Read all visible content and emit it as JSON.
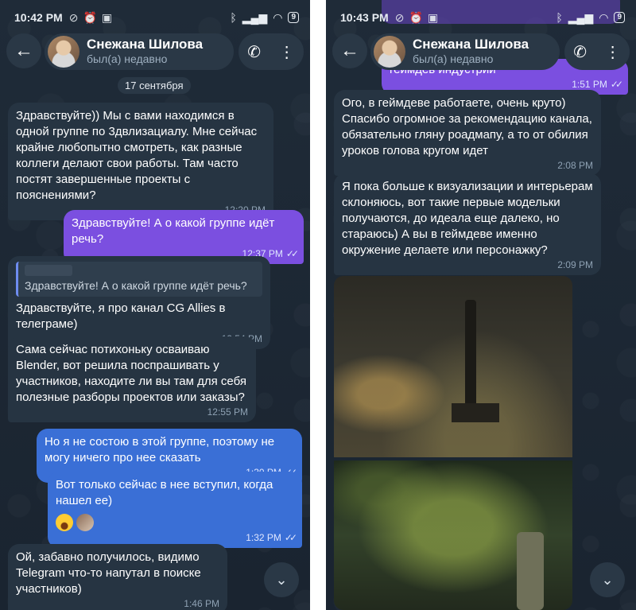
{
  "left": {
    "status": {
      "time": "10:42 PM",
      "battery": "9"
    },
    "contact": {
      "name": "Снежана Шилова",
      "status": "был(а) недавно"
    },
    "date": "17 сентября",
    "messages": [
      {
        "text": "Здравствуйте)) Мы с вами находимся в одной группе по 3двлизациалу. Мне сейчас крайне любопытно смотреть, как разные коллеги делают свои работы. Там часто постят завершенные проекты с пояснениями?",
        "time": "12:20 PM"
      },
      {
        "text": "Здравствуйте! А о какой группе идёт речь?",
        "time": "12:37 PM"
      },
      {
        "reply": "Здравствуйте! А о какой группе идёт речь?",
        "text": "Здравствуйте, я про канал CG Allies в телеграме)",
        "time": "12:54 PM"
      },
      {
        "text": "Сама сейчас потихоньку осваиваю Blender, вот решила поспрашивать у участников, находите ли вы там для себя полезные разборы проектов или заказы?",
        "time": "12:55 PM"
      },
      {
        "text": "Но я не состою в этой группе, поэтому не могу ничего про нее сказать",
        "time": "1:30 PM"
      },
      {
        "text": "Вот только сейчас в нее вступил, когда нашел ее)",
        "time": "1:32 PM"
      },
      {
        "text": "Ой, забавно получилось, видимо Telegram что-то напутал в поиске участников)",
        "time": "1:46 PM"
      }
    ]
  },
  "right": {
    "status": {
      "time": "10:43 PM",
      "battery": "9"
    },
    "contact": {
      "name": "Снежана Шилова",
      "status": "был(а) недавно"
    },
    "top_partial": {
      "text": "геймдев индустрии",
      "time": "1:51 PM"
    },
    "messages": [
      {
        "text": "Ого, в геймдеве работаете, очень круто) Спасибо огромное за рекомендацию канала, обязательно гляну роадмапу, а то от обилия уроков голова кругом идет",
        "time": "2:08 PM"
      },
      {
        "text": "Я пока больше к визуализации и интерьерам склоняюсь, вот такие первые модельки получаются, до идеала еще далеко, но стараюсь) А вы в геймдеве именно окружение делаете или персонажку?",
        "time": "2:09 PM"
      }
    ]
  },
  "icons": {
    "back": "arrow-left-icon",
    "call": "phone-icon",
    "menu": "more-vertical-icon",
    "scroll": "chevron-down-icon",
    "read": "double-check-icon"
  },
  "colors": {
    "background": "#1c2733",
    "incoming": "#263442",
    "outgoing_purple": "#7b4fe0",
    "outgoing_blue": "#3a6fd6"
  }
}
